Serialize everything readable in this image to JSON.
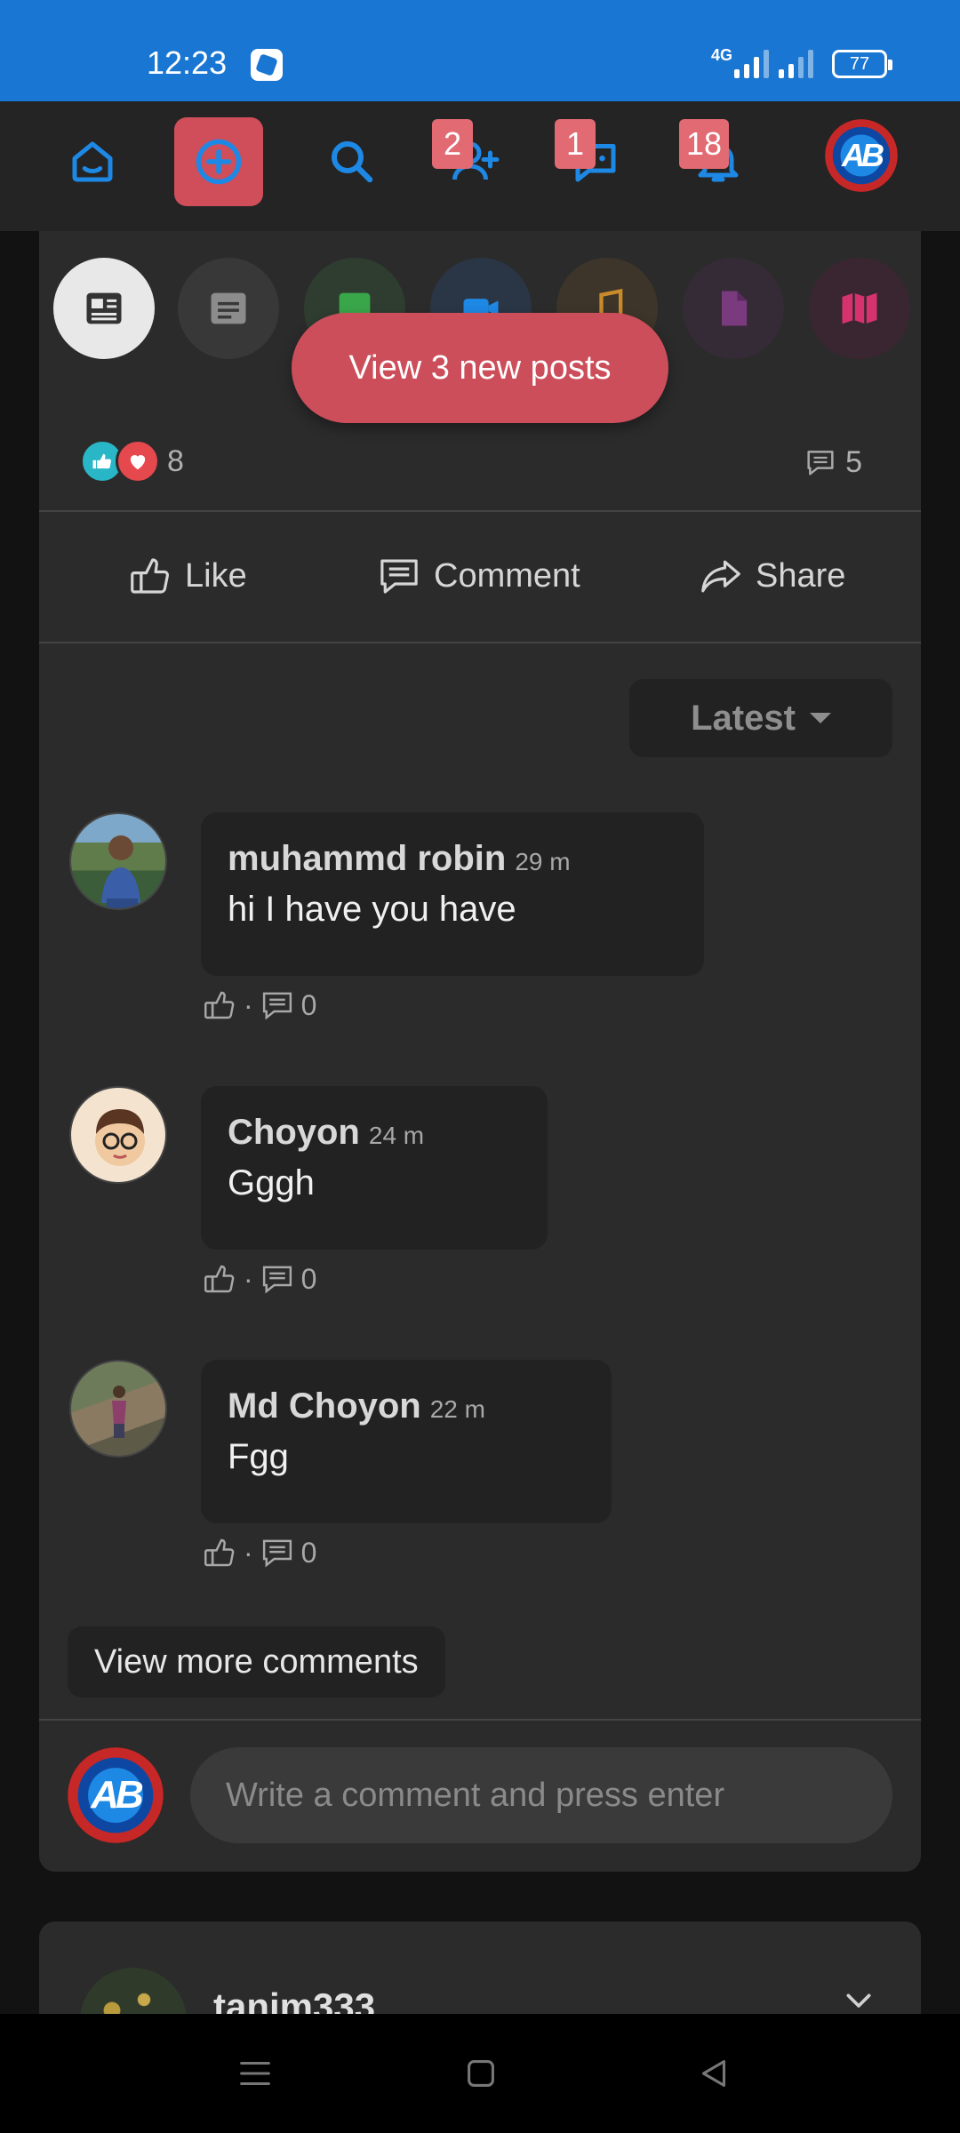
{
  "status_bar": {
    "time": "12:23",
    "network": "4G",
    "battery": "77"
  },
  "top_nav": {
    "items": [
      {
        "name": "home",
        "icon": "home-icon"
      },
      {
        "name": "create",
        "icon": "add-circle-icon"
      },
      {
        "name": "search",
        "icon": "search-icon"
      },
      {
        "name": "friend-requests",
        "icon": "add-friend-icon",
        "badge": "2"
      },
      {
        "name": "messages",
        "icon": "chat-icon",
        "badge": "1"
      },
      {
        "name": "notifications",
        "icon": "bell-icon",
        "badge": "18"
      },
      {
        "name": "profile",
        "icon": "avatar"
      }
    ],
    "accent": "#1e88e5",
    "create_bg": "#d04e5a"
  },
  "profile_initials": "AB",
  "post_types": [
    "news-icon",
    "text-icon",
    "image-icon",
    "video-icon",
    "music-icon",
    "file-icon",
    "book-icon"
  ],
  "new_posts_label": "View 3 new posts",
  "post": {
    "reaction_count": "8",
    "comment_count": "5",
    "actions": {
      "like": "Like",
      "comment": "Comment",
      "share": "Share"
    }
  },
  "sort_label": "Latest",
  "comments": [
    {
      "name": "muhammd robin",
      "time": "29 m",
      "text": "hi I have you have",
      "reply_count": "0"
    },
    {
      "name": "Choyon",
      "time": "24 m",
      "text": "Gggh",
      "reply_count": "0"
    },
    {
      "name": "Md Choyon",
      "time": "22 m",
      "text": "Fgg",
      "reply_count": "0"
    }
  ],
  "meta_separator": "·",
  "view_more_label": "View more comments",
  "composer_placeholder": "Write a comment and press enter",
  "next_post": {
    "author": "tanim333"
  }
}
